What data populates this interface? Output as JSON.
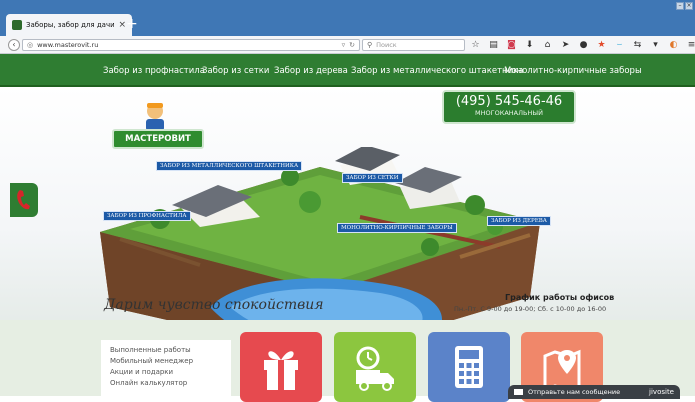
{
  "browser": {
    "tab_title": "Заборы, забор для дачи. М...",
    "tab_close": "×",
    "new_tab": "+",
    "url": "www.masterovit.ru",
    "search_placeholder": "Поиск",
    "toolbar_icons": [
      "star-icon",
      "clipboard-icon",
      "pocket-icon",
      "download-icon",
      "home-icon",
      "send-icon",
      "chat-icon",
      "star-badge-icon",
      "swoosh-icon",
      "sync-icon",
      "dropdown-icon",
      "addon-icon",
      "menu-icon"
    ]
  },
  "menu": {
    "items": [
      "Забор из профнастила",
      "Забор из сетки",
      "Забор из дерева",
      "Забор из металлического штакетника",
      "Монолитно-кирпичные заборы"
    ]
  },
  "hero": {
    "phone": "(495) 545-46-46",
    "phone_sub": "МНОГОКАНАЛЬНЫЙ",
    "logo": "МАСТЕРОВИТ",
    "labels": {
      "metal": "ЗАБОР ИЗ МЕТАЛЛИЧЕСКОГО ШТАКЕТНИКА",
      "mesh": "ЗАБОР ИЗ СЕТКИ",
      "profnastil": "ЗАБОР ИЗ ПРОФНАСТИЛА",
      "brick": "МОНОЛИТНО-КИРПИЧНЫЕ ЗАБОРЫ",
      "wood": "ЗАБОР ИЗ ДЕРЕВА"
    },
    "slogan": "Дарим чувство спокойствия",
    "schedule_title": "График работы офисов",
    "schedule_text": "Пн.-Пт. С 9-00 до 19-00; Сб. с 10-00 до 16-00"
  },
  "sidebar": {
    "items": [
      "Выполненные работы",
      "Мобильный менеджер",
      "Акции и подарки",
      "Онлайн калькулятор"
    ]
  },
  "tiles": [
    {
      "icon": "gift-icon",
      "color": "#e64a4f"
    },
    {
      "icon": "delivery-truck-icon",
      "color": "#8cc63f"
    },
    {
      "icon": "calculator-icon",
      "color": "#5b83c9"
    },
    {
      "icon": "map-pin-icon",
      "color": "#f0876a"
    }
  ],
  "chat": {
    "text": "Отправьте нам сообщение",
    "brand": "jivosite"
  }
}
